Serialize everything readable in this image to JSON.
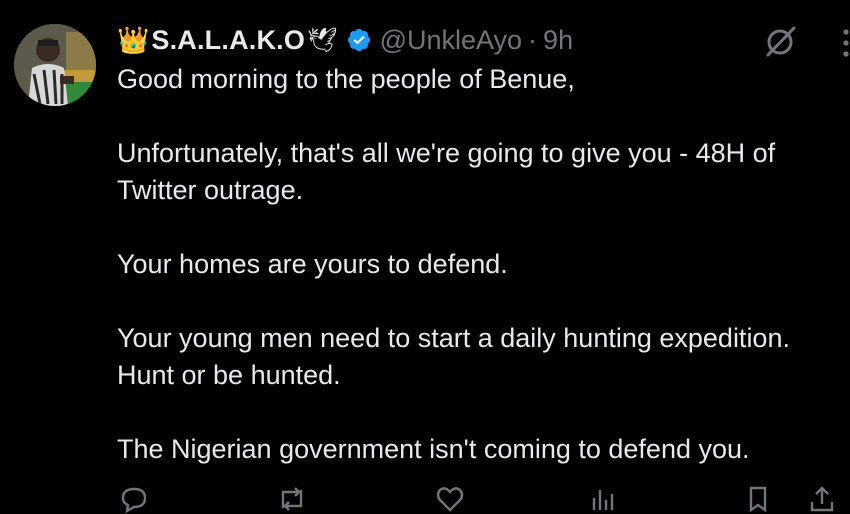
{
  "tweet": {
    "author": {
      "crown_emoji": "👑",
      "display_name": "S.A.L.A.K.O",
      "dove_emoji": "🕊",
      "handle": "@UnkleAyo",
      "separator": "·",
      "time": "9h",
      "verified": true
    },
    "lines": [
      "Good morning to the people of Benue,",
      "Unfortunately, that's all we're going to give you - 48H of Twitter outrage.",
      "Your homes are yours to defend.",
      "Your young men need to start a daily hunting expedition. Hunt or be hunted.",
      "The Nigerian government isn't coming to defend you."
    ],
    "actions": [
      "reply-icon",
      "retweet-icon",
      "like-icon",
      "views-icon",
      "bookmark-icon",
      "share-icon"
    ],
    "icons": {
      "grok": "grok-icon",
      "more": "more-icon"
    },
    "colors": {
      "background": "#000000",
      "text": "#e7e9ea",
      "secondary": "#71767b",
      "verified": "#1d9bf0"
    }
  }
}
